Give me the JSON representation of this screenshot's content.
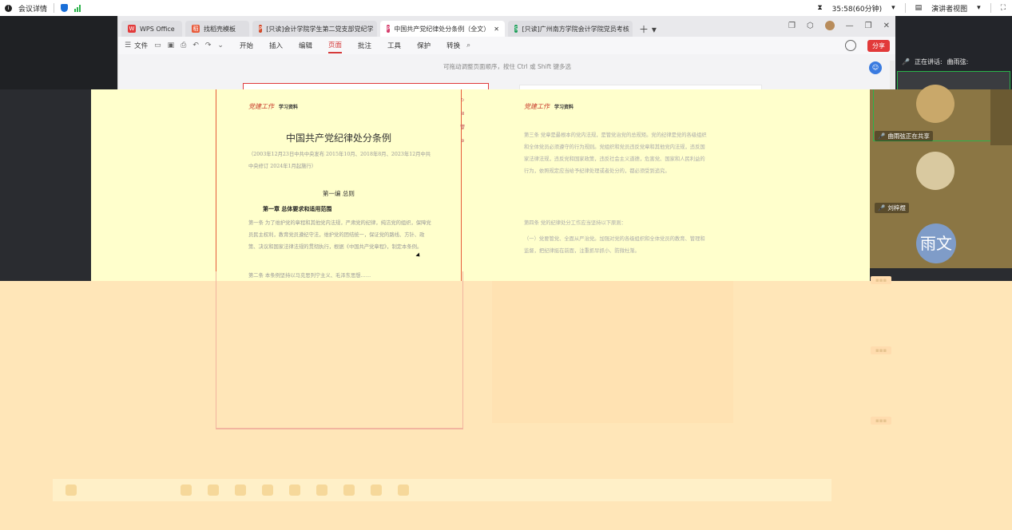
{
  "meeting_bar": {
    "info_label": "会议详情",
    "timer": "35:58(60分钟)",
    "view_label": "演讲者视图"
  },
  "wps": {
    "tabs": [
      {
        "label": "WPS Office",
        "icon": "W",
        "color": "#e23a3a"
      },
      {
        "label": "找稻壳模板",
        "icon": "稻",
        "color": "#e85a3a"
      },
      {
        "label": "[只读]会计学院学生第二党支部党纪学",
        "icon": "P",
        "color": "#d24726"
      },
      {
        "label": "中国共产党纪律处分条例（全文）",
        "icon": "P",
        "color": "#d53a6a",
        "active": true
      },
      {
        "label": "[只读]广州南方学院会计学院党员考核",
        "icon": "S",
        "color": "#1e9e5a"
      }
    ],
    "file_menu": "文件",
    "menu": [
      "开始",
      "插入",
      "编辑",
      "页面",
      "批注",
      "工具",
      "保护",
      "转换"
    ],
    "active_menu": "页面",
    "share_label": "分享",
    "hint": "可拖动调整页面顺序，按住 Ctrl 或 Shift 键多选"
  },
  "presenter": {
    "speaking_label": "正在讲话:",
    "speaker_name": "曲雨弦:"
  },
  "document": {
    "header_logo": "党建工作",
    "header_tag": "学习资料",
    "title": "中国共产党纪律处分条例",
    "preamble": "（2003年12月23日中共中央发布 2015年10月、2018年8月、2023年12月中共中央修订 2024年1月起施行）",
    "part": "第一编  总则",
    "chapter": "第一章  总体要求和适用范围",
    "article1": "第一条 为了维护党的章程和其他党内法规，严肃党的纪律，纯洁党的组织，保障党员民主权利，教育党员遵纪守法，维护党的团结统一，保证党的路线、方针、政策、决议和国家法律法规的贯彻执行，根据《中国共产党章程》，制定本条例。",
    "article2": "第二条 本条例坚持以马克思列宁主义、毛泽东思想……",
    "right_header_logo": "党建工作",
    "right_header_tag": "学习资料",
    "right_p1": "第三条 党章是最根本的党内法规，是管党治党的总规矩。党的纪律是党的各级组织和全体党员必须遵守的行为规则。党组织和党员违反党章和其他党内法规，违反国家法律法规，违反党和国家政策，违反社会主义道德，危害党、国家和人民利益的行为，依照规定应当给予纪律处理或者处分的，都必须受到追究。",
    "right_p2": "第四条 党的纪律处分工作应当坚持以下原则：",
    "right_p3": "（一）党要管党、全面从严治党。加强对党的各级组织和全体党员的教育、管理和监督，把纪律挺在前面，注重抓早抓小、防微杜渐。"
  },
  "participants": [
    {
      "name": "曲雨弦正在共享",
      "kind": "photo",
      "color": "#c9a86a"
    },
    {
      "name": "刘梓煜",
      "kind": "photo",
      "color": "#d9c9a0"
    },
    {
      "name": "",
      "kind": "letter",
      "letter": "雨文",
      "color": "#7f9cc8"
    }
  ]
}
